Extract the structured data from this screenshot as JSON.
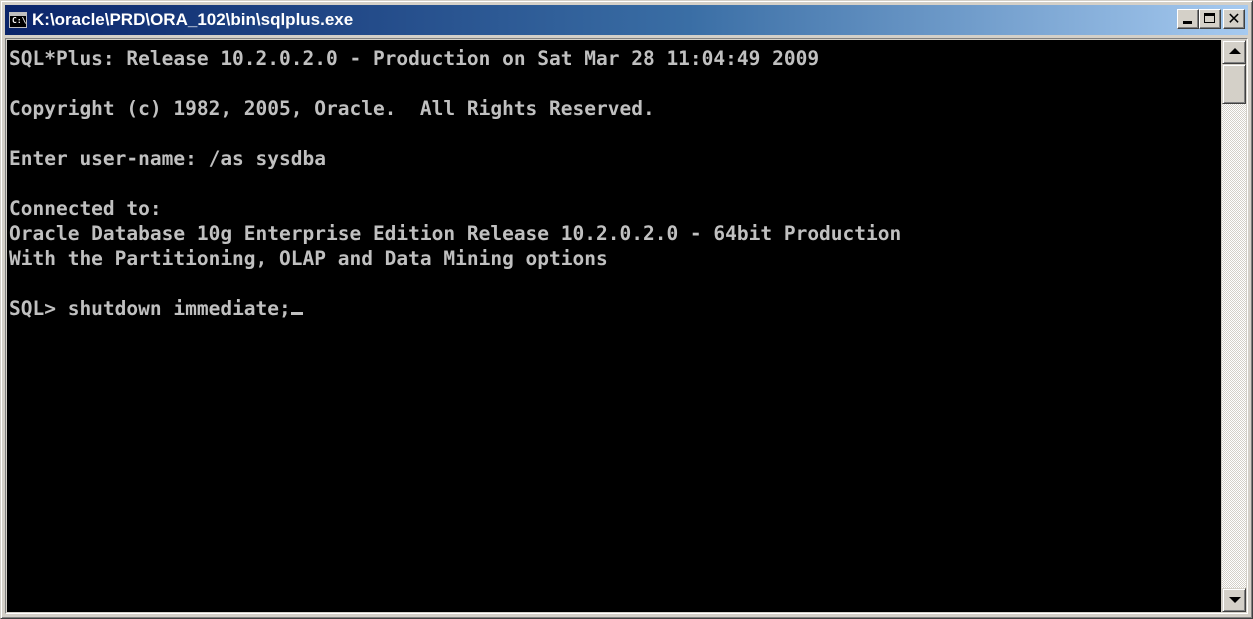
{
  "window": {
    "title": "K:\\oracle\\PRD\\ORA_102\\bin\\sqlplus.exe",
    "icon": "console-app-icon",
    "icon_text": "C:\\",
    "buttons": {
      "minimize": "minimize-icon",
      "maximize": "maximize-icon",
      "close": "close-icon",
      "close_glyph": "✕"
    }
  },
  "console": {
    "background": "#000000",
    "foreground": "#c0c0c0",
    "lines": [
      "SQL*Plus: Release 10.2.0.2.0 - Production on Sat Mar 28 11:04:49 2009",
      "",
      "Copyright (c) 1982, 2005, Oracle.  All Rights Reserved.",
      "",
      "Enter user-name: /as sysdba",
      "",
      "Connected to:",
      "Oracle Database 10g Enterprise Edition Release 10.2.0.2.0 - 64bit Production",
      "With the Partitioning, OLAP and Data Mining options",
      ""
    ],
    "prompt": "SQL> ",
    "input": "shutdown immediate;"
  },
  "scrollbar": {
    "up": "scroll-up-arrow-icon",
    "down": "scroll-down-arrow-icon"
  },
  "colors": {
    "titlebar_start": "#0a246a",
    "titlebar_end": "#a6caf0",
    "chrome": "#d4d0c8"
  }
}
